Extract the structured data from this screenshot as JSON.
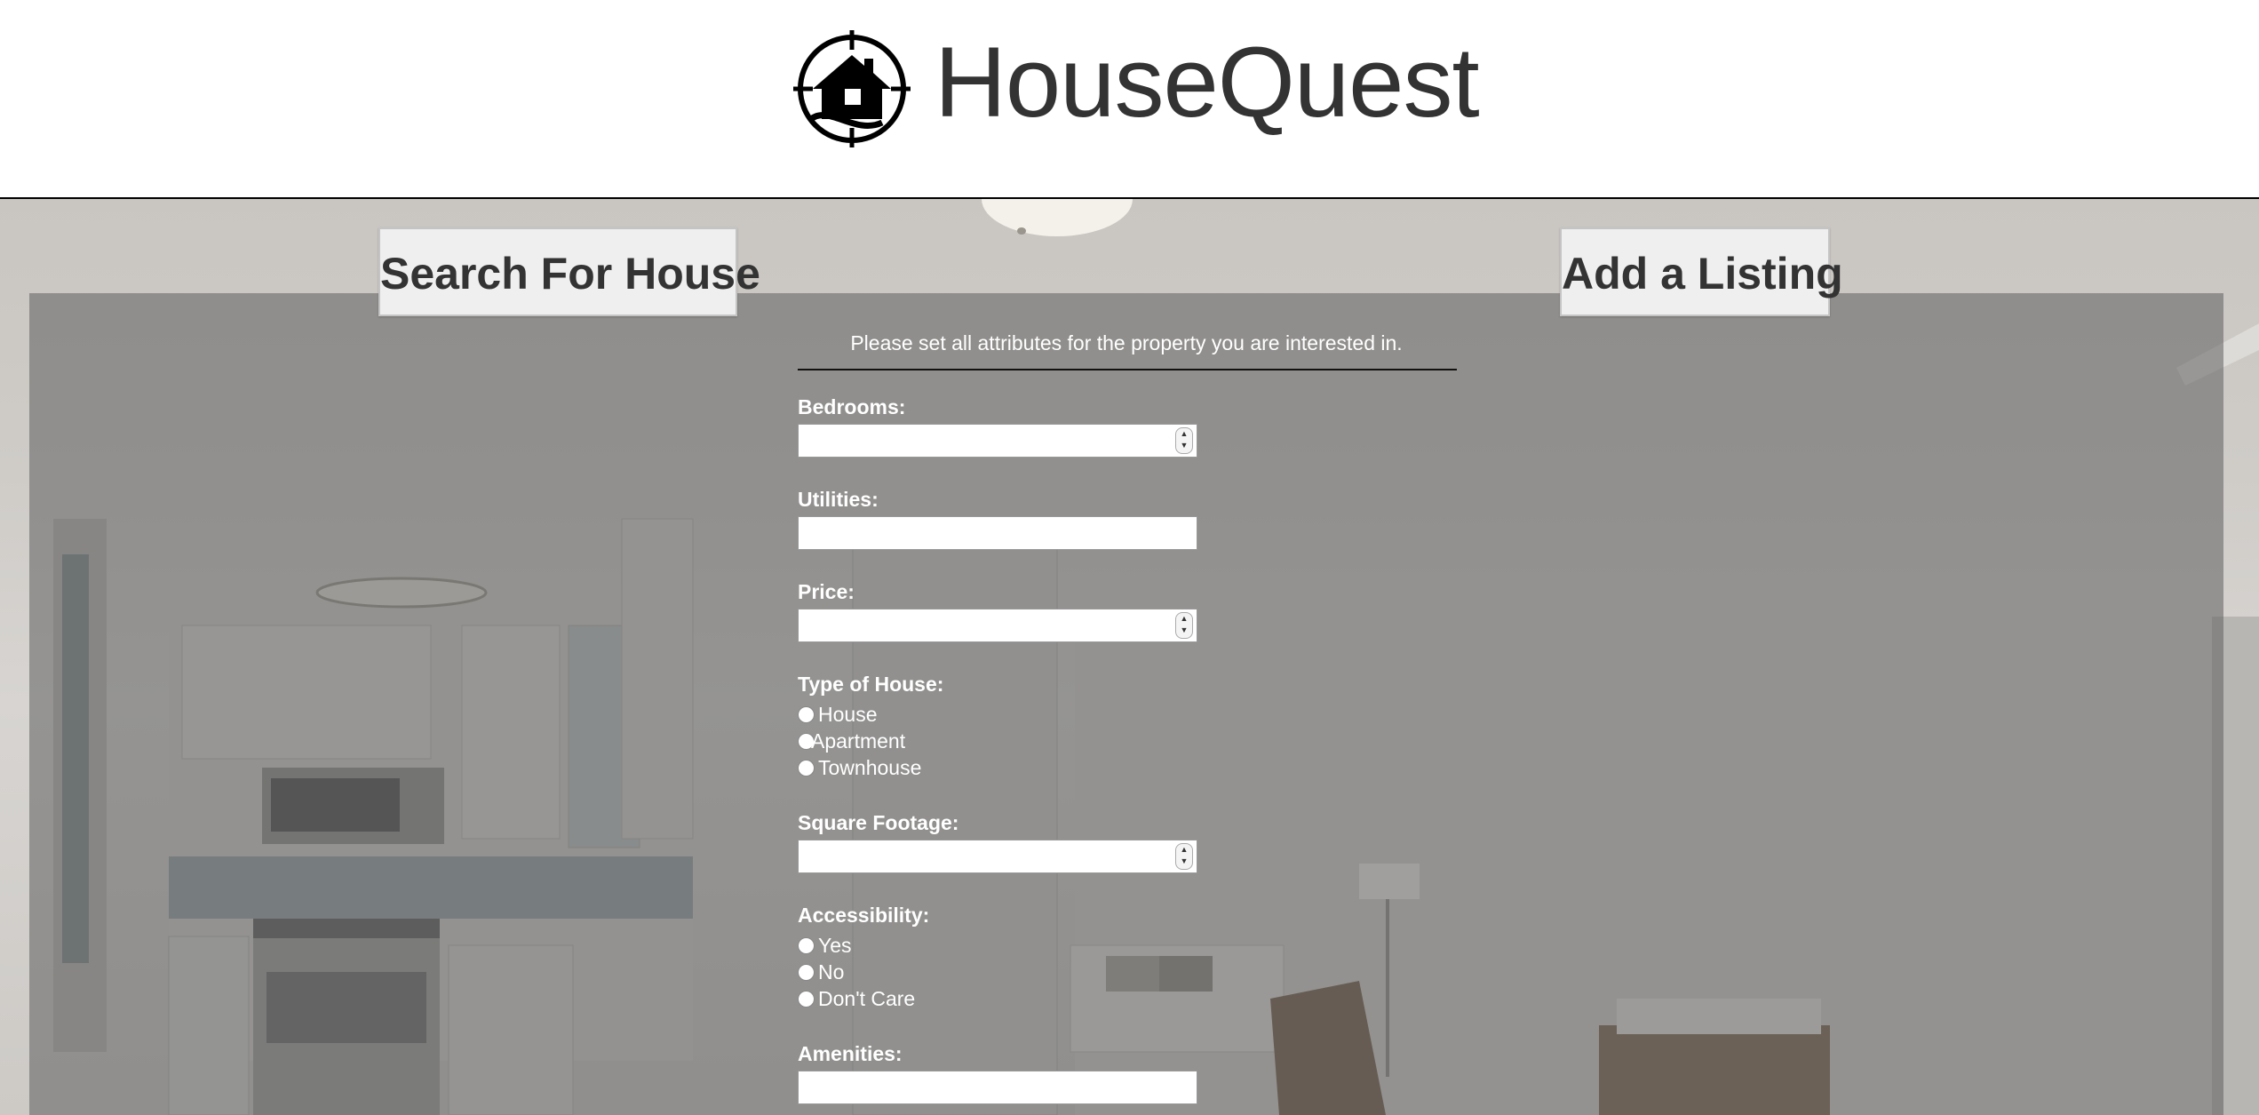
{
  "app": {
    "brand": "HouseQuest",
    "logo_icon": "house-crosshair-icon"
  },
  "nav": {
    "search_label": "Search For House",
    "add_label": "Add a Listing"
  },
  "form": {
    "intro": "Please set all attributes for the property you are interested in.",
    "bedrooms": {
      "label": "Bedrooms:",
      "value": ""
    },
    "utilities": {
      "label": "Utilities:",
      "value": ""
    },
    "price": {
      "label": "Price:",
      "value": ""
    },
    "type_of_house": {
      "label": "Type of House:",
      "options": [
        "House",
        "Apartment",
        "Townhouse"
      ]
    },
    "square_footage": {
      "label": "Square Footage:",
      "value": ""
    },
    "accessibility": {
      "label": "Accessibility:",
      "options": [
        "Yes",
        "No",
        "Don't Care"
      ]
    },
    "amenities": {
      "label": "Amenities:",
      "value": ""
    }
  },
  "colors": {
    "overlay": "#5f5f5f",
    "header_bg": "#ffffff",
    "button_bg": "#efefef",
    "text_light": "#ffffff",
    "text_dark": "#333333"
  }
}
